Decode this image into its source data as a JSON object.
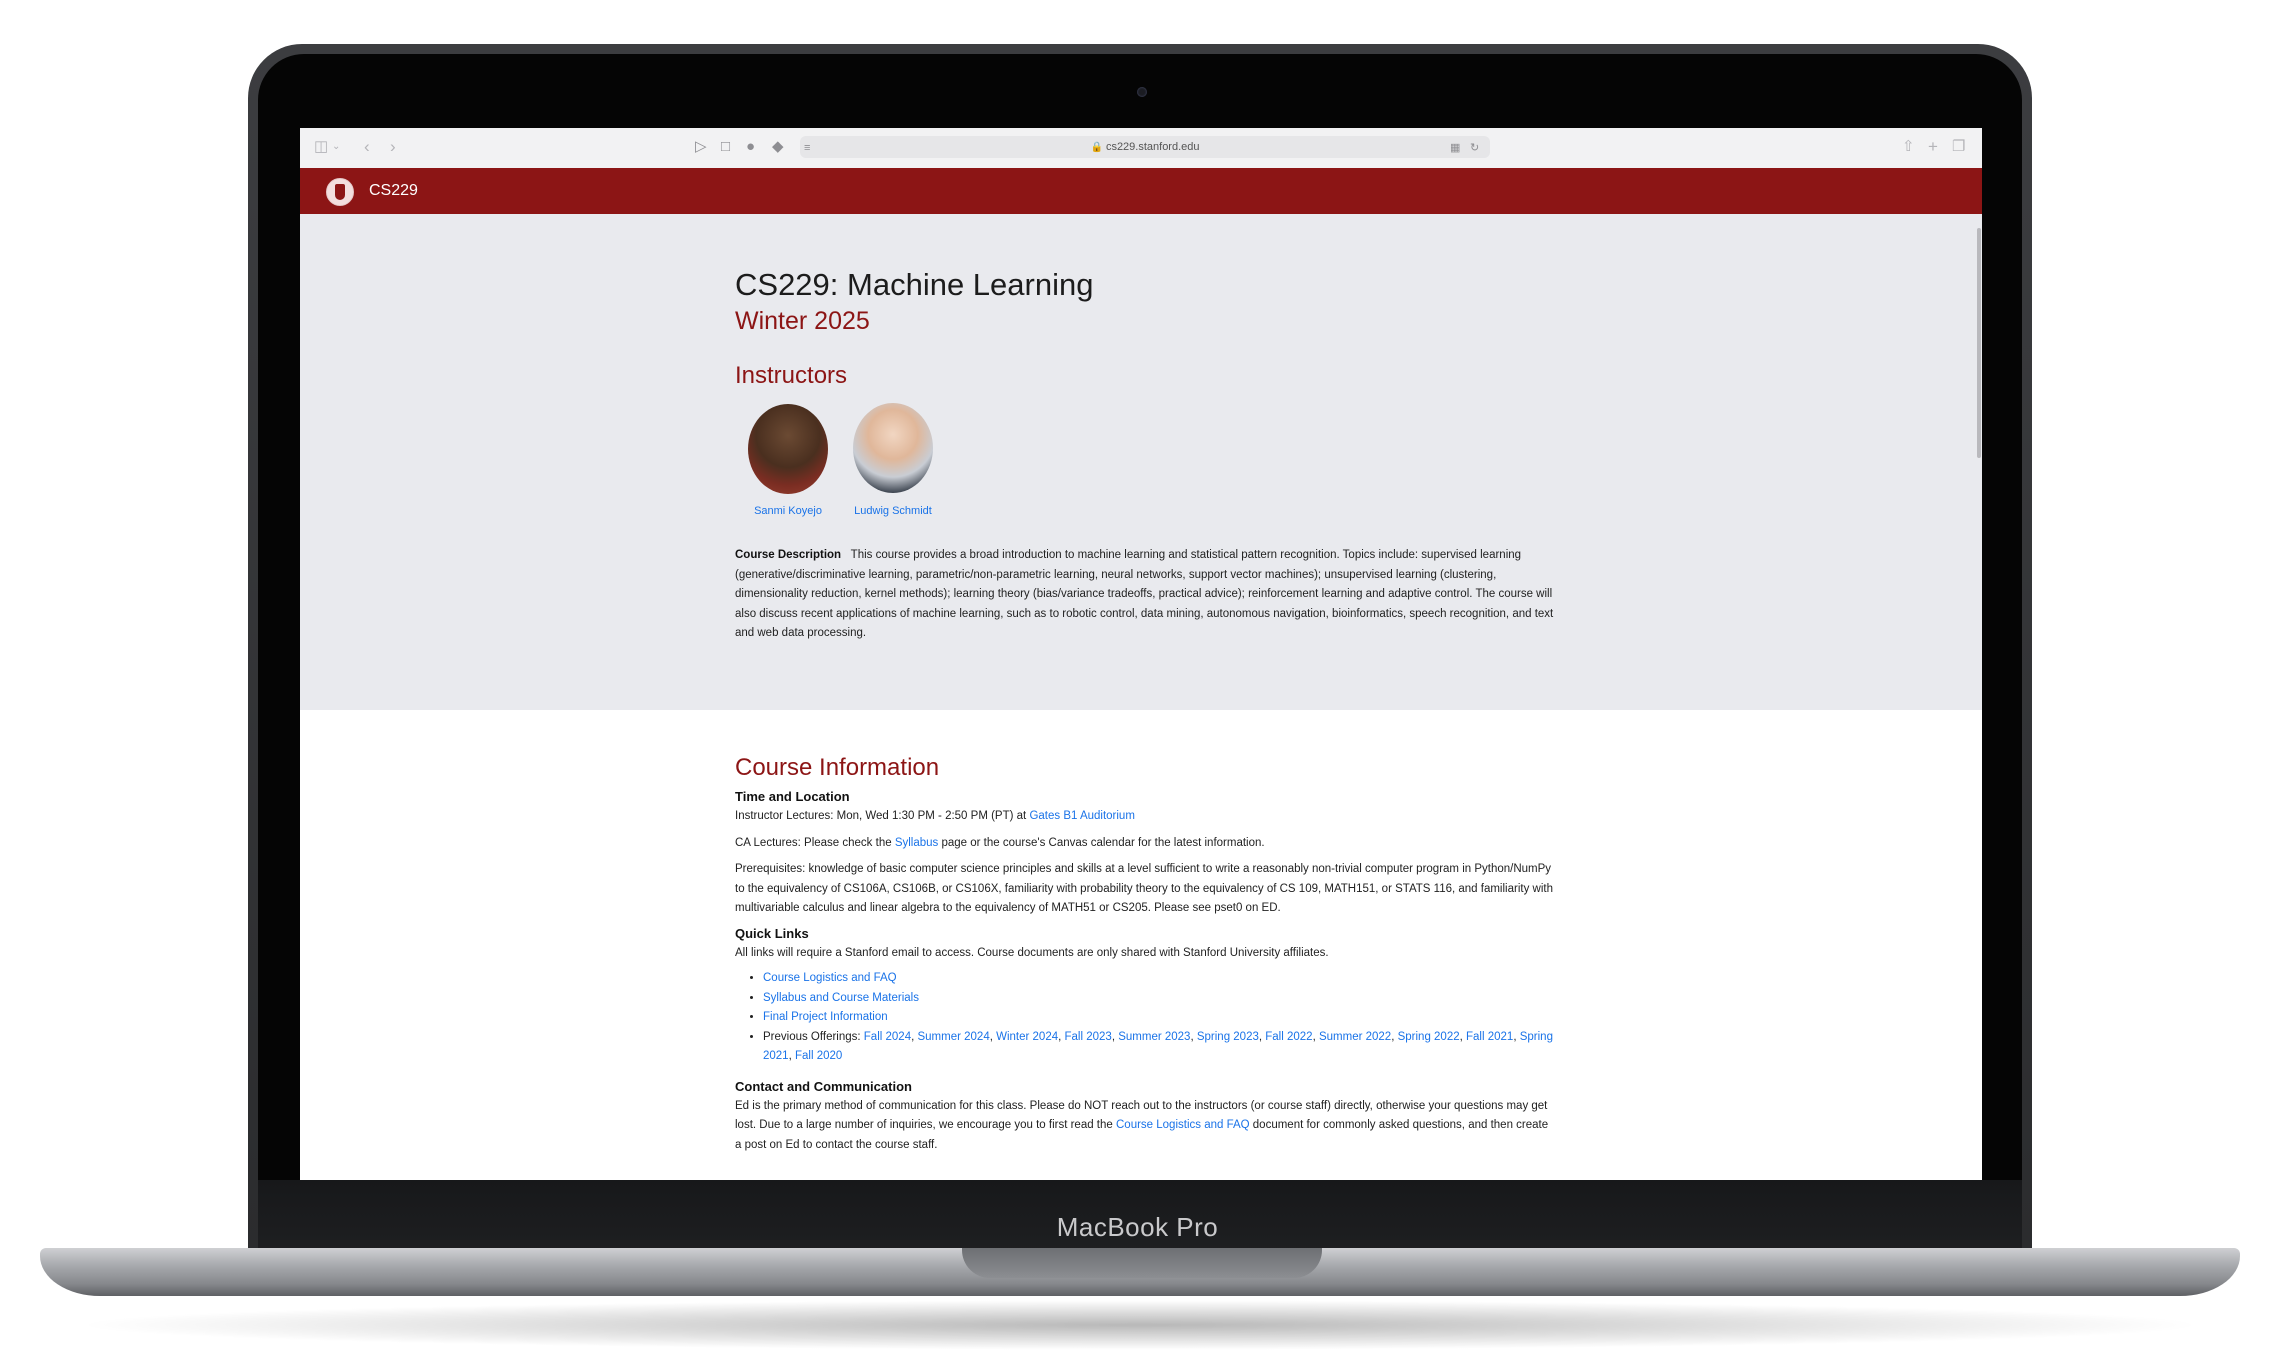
{
  "device": {
    "label": "MacBook Pro"
  },
  "browser": {
    "url": "cs229.stanford.edu"
  },
  "navbar": {
    "title": "CS229"
  },
  "hero": {
    "title": "CS229: Machine Learning",
    "term": "Winter 2025",
    "instructors_heading": "Instructors",
    "instructors": [
      {
        "name": "Sanmi Koyejo"
      },
      {
        "name": "Ludwig Schmidt"
      }
    ],
    "description_label": "Course Description",
    "description_text": "This course provides a broad introduction to machine learning and statistical pattern recognition. Topics include: supervised learning (generative/discriminative learning, parametric/non-parametric learning, neural networks, support vector machines); unsupervised learning (clustering, dimensionality reduction, kernel methods); learning theory (bias/variance tradeoffs, practical advice); reinforcement learning and adaptive control. The course will also discuss recent applications of machine learning, such as to robotic control, data mining, autonomous navigation, bioinformatics, speech recognition, and text and web data processing."
  },
  "course_info": {
    "heading": "Course Information",
    "time_location_heading": "Time and Location",
    "lectures_prefix": "Instructor Lectures: Mon, Wed 1:30 PM - 2:50 PM (PT) at ",
    "lectures_location": "Gates B1 Auditorium",
    "ca_prefix": "CA Lectures: Please check the ",
    "ca_link": "Syllabus",
    "ca_suffix": " page or the course's Canvas calendar for the latest information.",
    "prereq_text": "Prerequisites: knowledge of basic computer science principles and skills at a level sufficient to write a reasonably non-trivial computer program in Python/NumPy to the equivalency of CS106A, CS106B, or CS106X, familiarity with probability theory to the equivalency of CS 109, MATH151, or STATS 116, and familiarity with multivariable calculus and linear algebra to the equivalency of MATH51 or CS205. Please see pset0 on ED.",
    "quick_links_heading": "Quick Links",
    "quick_links_note": "All links will require a Stanford email to access. Course documents are only shared with Stanford University affiliates.",
    "quick_links": [
      "Course Logistics and FAQ",
      "Syllabus and Course Materials",
      "Final Project Information"
    ],
    "previous_label": "Previous Offerings: ",
    "previous_offerings": [
      "Fall 2024",
      "Summer 2024",
      "Winter 2024",
      "Fall 2023",
      "Summer 2023",
      "Spring 2023",
      "Fall 2022",
      "Summer 2022",
      "Spring 2022",
      "Fall 2021",
      "Spring 2021",
      "Fall 2020"
    ],
    "contact_heading": "Contact and Communication",
    "contact_text_1": "Ed is the primary method of communication for this class. Please do NOT reach out to the instructors (or course staff) directly, otherwise your questions may get lost. Due to a large number of inquiries, we encourage you to first read the ",
    "contact_link": "Course Logistics and FAQ",
    "contact_text_2": " document for commonly asked questions, and then create a post on Ed to contact the course staff."
  }
}
